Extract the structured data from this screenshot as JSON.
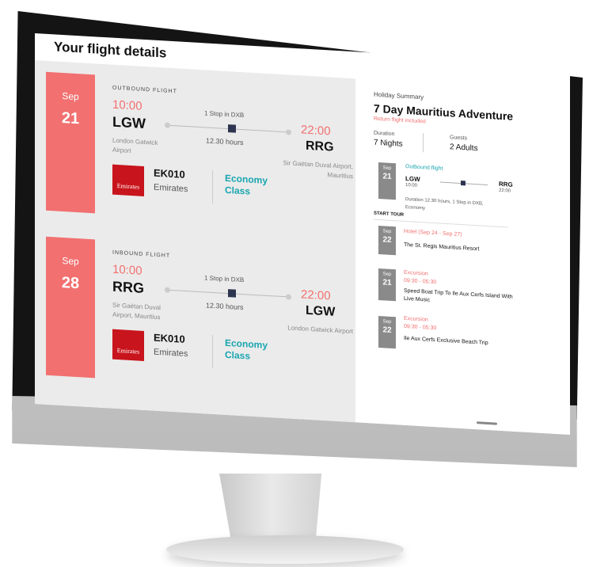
{
  "page_title": "Your flight details",
  "outbound": {
    "month": "Sep",
    "day": "21",
    "type_label": "OUTBOUND FLIGHT",
    "dep_time": "10:00",
    "from_code": "LGW",
    "from_name": "London Gatwick Airport",
    "stops": "1 Stop in DXB",
    "duration": "12.30 hours",
    "arr_time": "22:00",
    "to_code": "RRG",
    "to_name": "Sir Gaëtan Duval Airport, Mauritius",
    "flight_no": "EK010",
    "airline": "Emirates",
    "logo_text": "Emirates",
    "cabin": "Economy Class"
  },
  "inbound": {
    "month": "Sep",
    "day": "28",
    "type_label": "INBOUND FLIGHT",
    "dep_time": "10:00",
    "from_code": "RRG",
    "from_name": "Sir Gaëtan Duval Airport, Mauritius",
    "stops": "1 Stop in DXB",
    "duration": "12.30 hours",
    "arr_time": "22:00",
    "to_code": "LGW",
    "to_name": "London Gatwick Airport",
    "flight_no": "EK010",
    "airline": "Emirates",
    "logo_text": "Emirates",
    "cabin": "Economy Class"
  },
  "holiday": {
    "label": "Holiday Summary",
    "title": "7 Day Mauritius Adventure",
    "note": "Return flight included",
    "duration_label": "Duration",
    "duration_value": "7 Nights",
    "guests_label": "Guests",
    "guests_value": "2 Adults",
    "outbound": {
      "month": "Sep",
      "day": "21",
      "heading": "Outbound flight",
      "from": "LGW",
      "dep": "10:00",
      "to": "RRG",
      "arr": "22:00",
      "meta": "Duration 12.30 hours, 1 Stop in DXB, Economy"
    },
    "tour_heading": "START TOUR",
    "items": [
      {
        "month": "Sep",
        "day": "22",
        "type": "Hotel (Sep 24 - Sep 27)",
        "time": "",
        "name": "The St. Regis Mauritius Resort"
      },
      {
        "month": "Sep",
        "day": "21",
        "type": "Excursion",
        "time": "09:30 - 05:30",
        "name": "Speed Boat Trip To Ile Aux Cerfs Island With Live Music"
      },
      {
        "month": "Sep",
        "day": "22",
        "type": "Excursion",
        "time": "09:30 - 05:30",
        "name": "Ile Aux Cerfs Exclusive Beach Trip"
      }
    ]
  },
  "colors": {
    "accent": "#f27070",
    "teal": "#1aa6b0",
    "brand_red": "#c8141c"
  }
}
